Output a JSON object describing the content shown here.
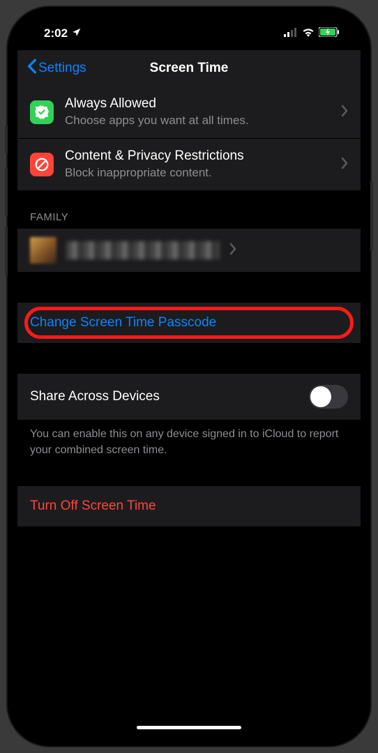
{
  "status": {
    "time": "2:02",
    "hasLocation": true
  },
  "nav": {
    "back": "Settings",
    "title": "Screen Time"
  },
  "rows": {
    "alwaysAllowed": {
      "title": "Always Allowed",
      "sub": "Choose apps you want at all times."
    },
    "contentPrivacy": {
      "title": "Content & Privacy Restrictions",
      "sub": "Block inappropriate content."
    }
  },
  "sections": {
    "family": "FAMILY"
  },
  "actions": {
    "changePasscode": "Change Screen Time Passcode",
    "shareAcross": "Share Across Devices",
    "shareFooter": "You can enable this on any device signed in to iCloud to report your combined screen time.",
    "turnOff": "Turn Off Screen Time"
  }
}
